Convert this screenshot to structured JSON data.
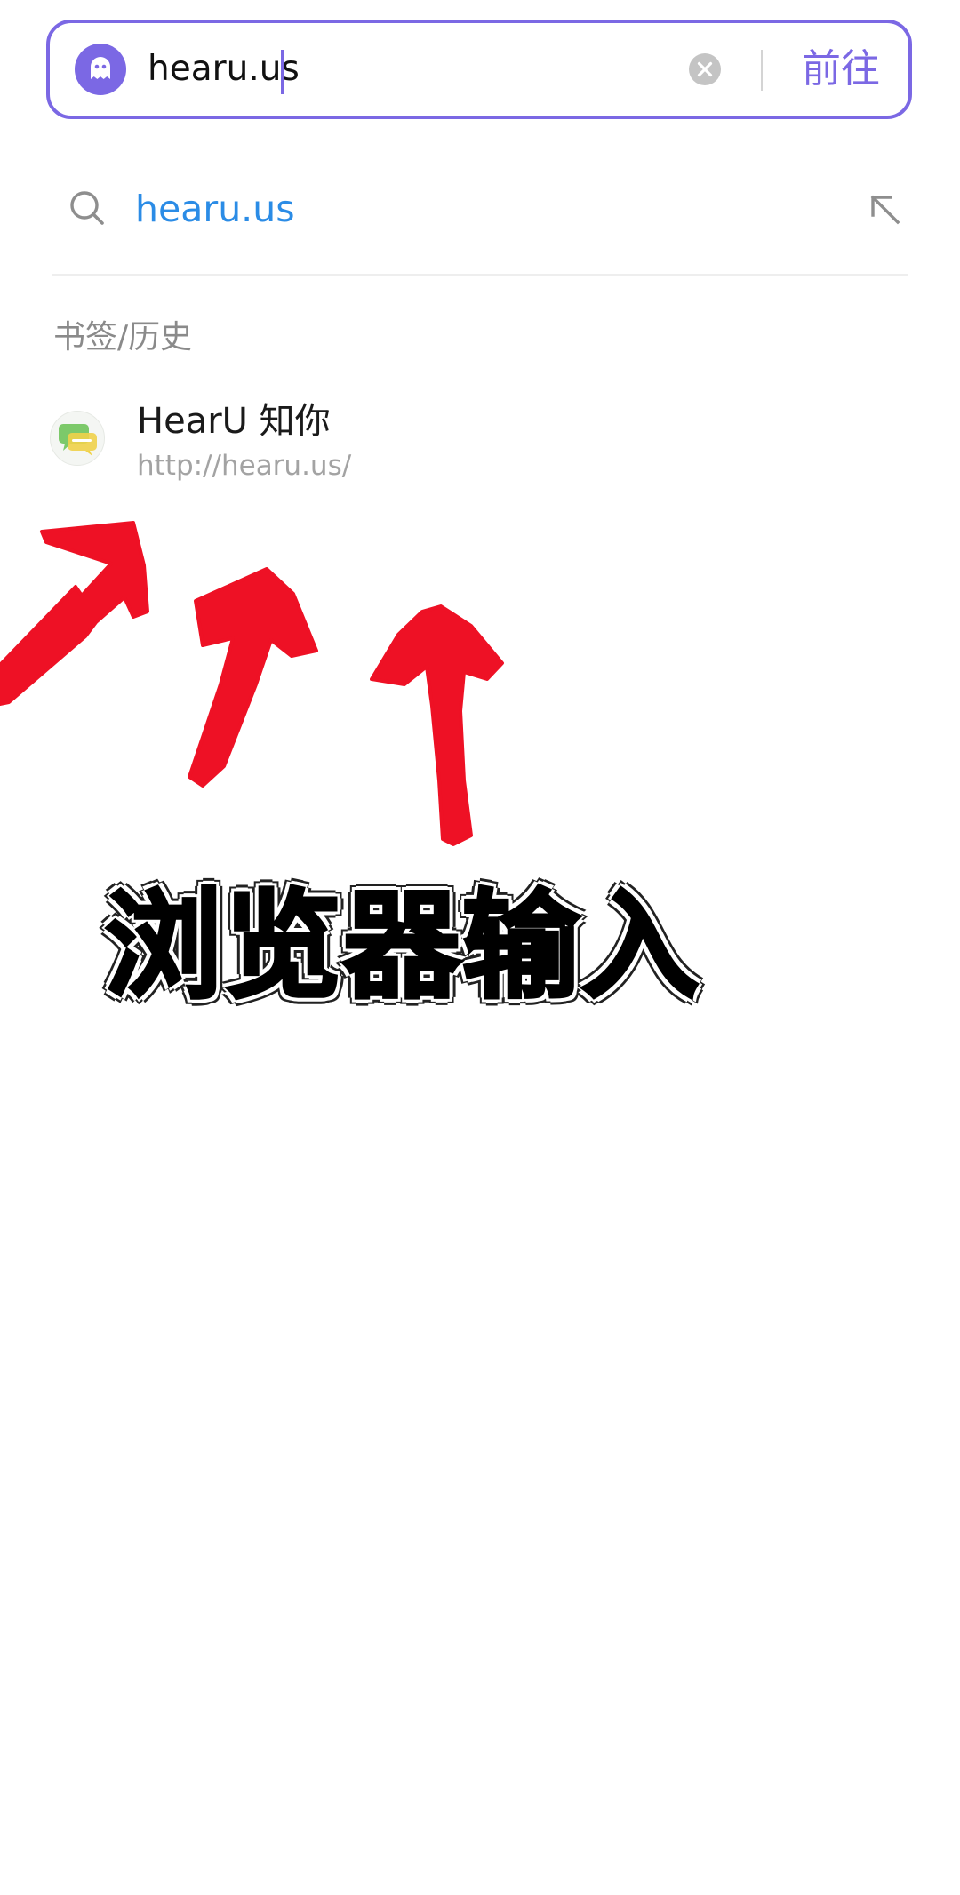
{
  "address_bar": {
    "value": "hearu.us",
    "go_label": "前往",
    "site_icon": "ghost-icon",
    "clear_icon": "clear-circle-icon",
    "accent_color": "#7b68e4"
  },
  "suggestion": {
    "text": "hearu.us",
    "leading_icon": "search-icon",
    "trailing_icon": "fill-arrow-icon",
    "text_color": "#2b8ce6"
  },
  "bookmarks_history": {
    "section_title": "书签/历史",
    "items": [
      {
        "title": "HearU 知你",
        "url": "http://hearu.us/",
        "icon": "hearu-favicon-icon"
      }
    ]
  },
  "annotation": {
    "caption": "浏览器输入",
    "arrow_color": "#ee1125",
    "arrow_count": 3
  }
}
